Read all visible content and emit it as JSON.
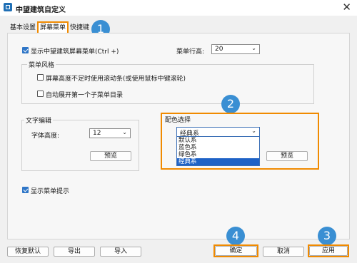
{
  "window": {
    "title": "中望建筑自定义",
    "close_glyph": "✕"
  },
  "tabs": [
    {
      "label": "基本设置"
    },
    {
      "label": "屏幕菜单",
      "active": true
    },
    {
      "label": "快捷键"
    }
  ],
  "badges": [
    "1",
    "2",
    "3",
    "4"
  ],
  "screen_menu": {
    "show_menu_label": "显示中望建筑屏幕菜单(Ctrl +)",
    "show_menu_checked": true,
    "row_height_label": "菜单行高:",
    "row_height_value": "20",
    "style_group_title": "菜单风格",
    "scrollbar_label": "屏幕高度不足时使用滚动条(或使用鼠标中键滚轮)",
    "scrollbar_checked": false,
    "expand_first_label": "自动展开第一个子菜单目录",
    "expand_first_checked": false
  },
  "text_editor": {
    "group_title": "文字编辑",
    "font_height_label": "字体高度:",
    "font_height_value": "12",
    "preview_label": "预览"
  },
  "color_scheme": {
    "group_title": "配色选择",
    "selected": "经典系",
    "options": [
      "默认系",
      "蓝色系",
      "绿色系",
      "经典系"
    ],
    "highlighted_option": "经典系",
    "preview_label": "预览"
  },
  "show_tips": {
    "label": "显示菜单提示",
    "checked": true
  },
  "footer": {
    "restore_label": "恢复默认",
    "export_label": "导出",
    "import_label": "导入",
    "ok_label": "确定",
    "cancel_label": "取消",
    "apply_label": "应用"
  },
  "colors": {
    "accent": "#f08a00",
    "badge": "#3a8fd3",
    "selection": "#1e62c6"
  }
}
